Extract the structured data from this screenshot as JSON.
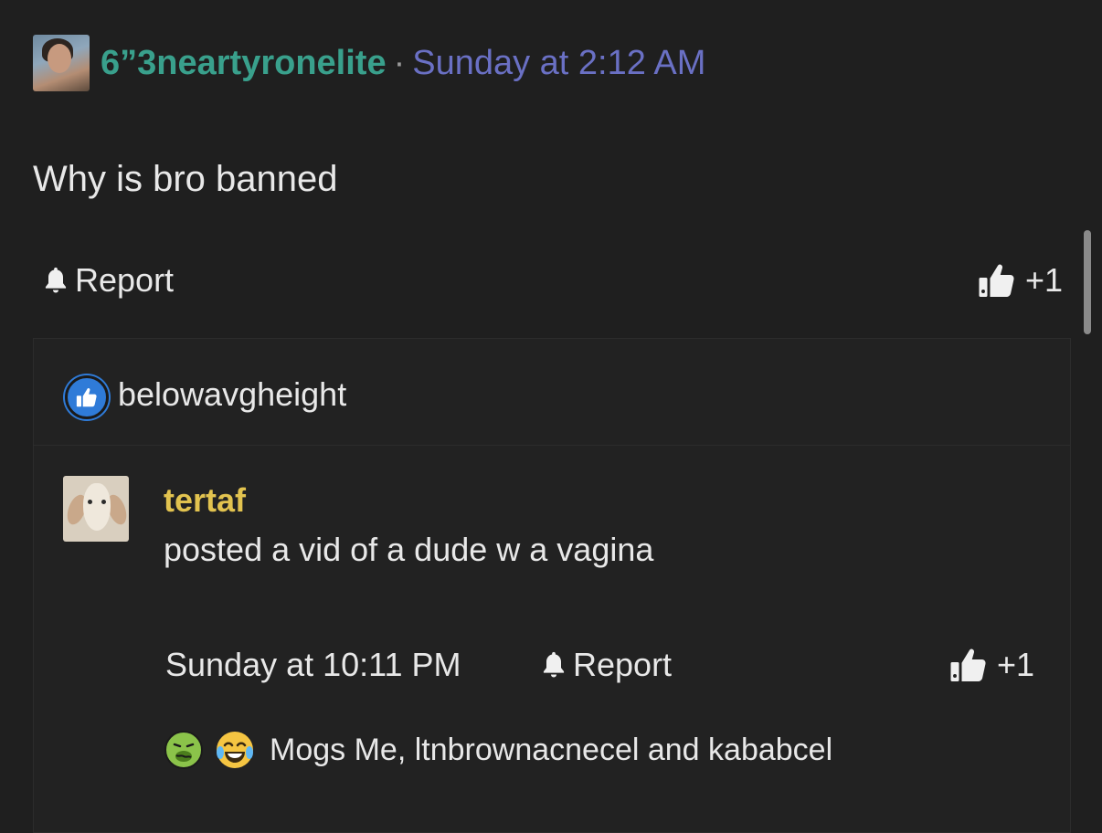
{
  "post": {
    "username": "6”3neartyronelite",
    "separator": "·",
    "timestamp": "Sunday at 2:12 AM",
    "body": "Why is bro banned",
    "report_label": "Report",
    "like_count": "+1"
  },
  "likers": {
    "name": "belowavgheight"
  },
  "reply": {
    "username": "tertaf",
    "body": "posted a vid of a dude w a vagina",
    "timestamp": "Sunday at 10:11 PM",
    "report_label": "Report",
    "like_count": "+1",
    "reactions_text": "Mogs Me, ltnbrownacnecel and kababcel",
    "reaction_icons": [
      "sick-face-icon",
      "laughing-crying-face-icon"
    ]
  },
  "colors": {
    "background": "#1f1f1f",
    "username_teal": "#39a08c",
    "timestamp_blue": "#6a70c4",
    "reply_username_yellow": "#e2c34f",
    "like_badge_blue": "#2f7bd8"
  }
}
